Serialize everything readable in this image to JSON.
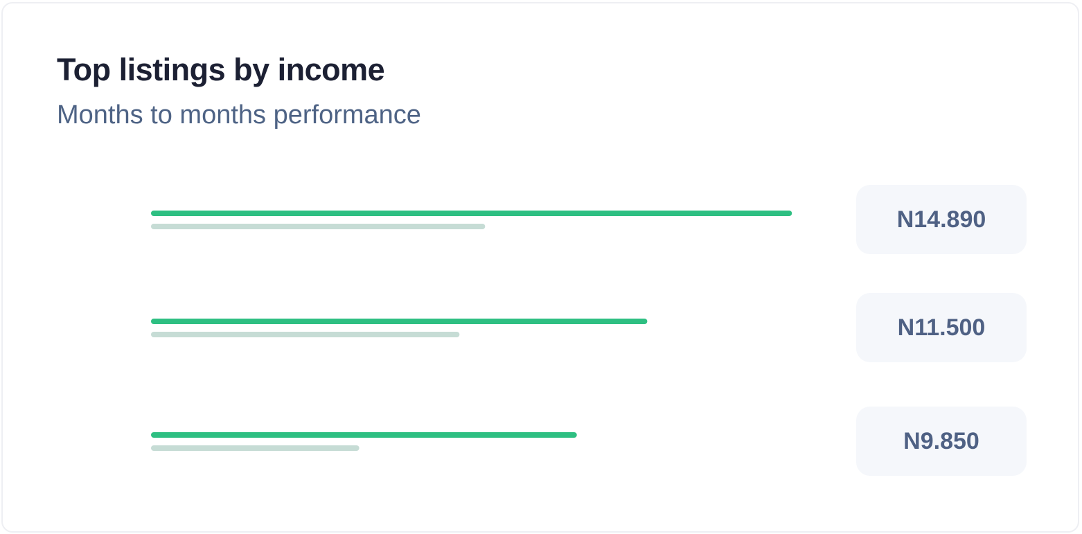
{
  "card": {
    "title": "Top listings by income",
    "subtitle": "Months to months performance"
  },
  "chart_data": {
    "type": "bar",
    "title": "Top listings by income",
    "subtitle": "Months to months performance",
    "orientation": "horizontal",
    "categories": [
      "",
      "",
      ""
    ],
    "value_labels": [
      "N14.890",
      "N11.500",
      "N9.850"
    ],
    "series": [
      {
        "values": [
          14890,
          11500,
          9850
        ],
        "color": "#2ebf82"
      },
      {
        "values": [
          7700,
          7100,
          4750
        ],
        "color": "#c6dcd5"
      }
    ],
    "xlim": [
      0,
      15000
    ],
    "grid": false,
    "legend": "none"
  },
  "colors": {
    "primary_bar": "#2ebf82",
    "secondary_bar": "#c6dcd5",
    "badge_background": "#f5f7fb",
    "badge_text": "#4f6184",
    "title": "#1c2033",
    "subtitle": "#4e6385"
  }
}
